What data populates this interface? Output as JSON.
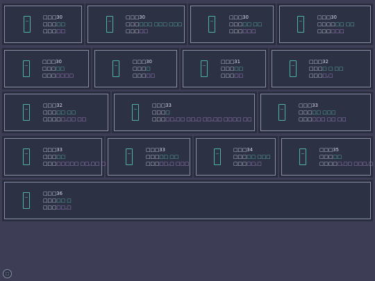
{
  "cards": [
    {
      "row": 0,
      "title": "□□□30",
      "l2a": "□□□",
      "l2b": "□□",
      "l2c": "",
      "l3a": "□□□",
      "l3b": "□□"
    },
    {
      "row": 0,
      "title": "□□□30",
      "l2a": "□□□",
      "l2b": "□□□  □□□  □□□",
      "l2c": "",
      "l3a": "□□□",
      "l3b": "□□"
    },
    {
      "row": 0,
      "title": "□□□30",
      "l2a": "□□□",
      "l2b": "□□  □□",
      "l2c": "",
      "l3a": "□□□",
      "l3b": "□□□"
    },
    {
      "row": 0,
      "title": "□□□30",
      "l2a": "□□□□",
      "l2b": "□□  □□",
      "l2c": "",
      "l3a": "□□□",
      "l3b": "□□□"
    },
    {
      "row": 1,
      "title": "□□□30",
      "l2a": "□□□",
      "l2b": "□□",
      "l2c": "",
      "l3a": "□□□",
      "l3b": "□□□□"
    },
    {
      "row": 1,
      "title": "□□□30",
      "l2a": "□□□",
      "l2b": "□",
      "l2c": "",
      "l3a": "□□□",
      "l3b": "□□"
    },
    {
      "row": 1,
      "title": "□□□31",
      "l2a": "□□□",
      "l2b": "□□",
      "l2c": "",
      "l3a": "□□□",
      "l3b": "□□"
    },
    {
      "row": 1,
      "title": "□□□32",
      "l2a": "□□□",
      "l2b": "□  □  □□",
      "l2c": "",
      "l3a": "□□□",
      "l3b": "□,□"
    },
    {
      "row": 2,
      "title": "□□□32",
      "l2a": "□□□",
      "l2b": "□□  □□",
      "l2c": "",
      "l3a": "□□□□",
      "l3b": "□,□□  □□"
    },
    {
      "row": 2,
      "title": "□□□33",
      "l2a": "□□□",
      "l2b": "□",
      "l2c": "",
      "l3a": "□□□",
      "l3b": "□□,□□  □□,□  □□,□□  □□□□  □□"
    },
    {
      "row": 2,
      "title": "□□□33",
      "l2a": "□□□",
      "l2b": "□□  □□□",
      "l2c": "",
      "l3a": "□□□",
      "l3b": "□□□  □□  □□"
    },
    {
      "row": 3,
      "title": "□□□33",
      "l2a": "□□□",
      "l2b": "□□",
      "l2c": "",
      "l3a": "□□□",
      "l3b": "□□□□□  □□,□□  □□□"
    },
    {
      "row": 3,
      "title": "□□□33",
      "l2a": "□□□",
      "l2b": "□□  □□",
      "l2c": "",
      "l3a": "□□□",
      "l3b": "□□,□  □□□"
    },
    {
      "row": 3,
      "title": "□□□34",
      "l2a": "□□□",
      "l2b": "□□  □□□",
      "l2c": "",
      "l3a": "□□□",
      "l3b": "□□,□"
    },
    {
      "row": 3,
      "title": "□□□35",
      "l2a": "□□□",
      "l2b": "□□",
      "l2c": "",
      "l3a": "□□□□",
      "l3b": "□,□□  □□□,□"
    },
    {
      "row": 4,
      "title": "□□□36",
      "l2a": "□□□",
      "l2b": "□□  □",
      "l2c": "",
      "l3a": "□□□",
      "l3b": "□□,□"
    }
  ],
  "badge": "□",
  "colors": {
    "bg": "#3d3d55",
    "card": "#2d3144",
    "teal": "#5fc0b6",
    "purple": "#b58bd8"
  }
}
